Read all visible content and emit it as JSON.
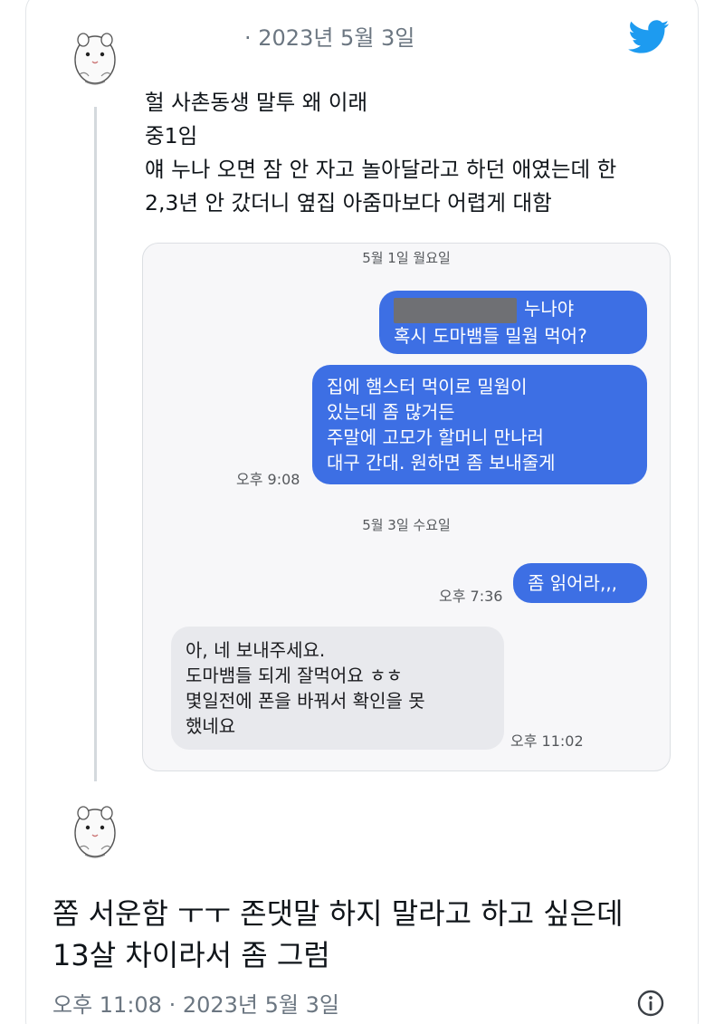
{
  "tweet": {
    "date": "· 2023년 5월 3일",
    "lines": [
      "헐 사촌동생 말투 왜 이래",
      "중1임",
      "얘 누나 오면 잠 안 자고 놀아달라고 하던 애였는데 한",
      "2,3년 안 갔더니 옆집 아줌마보다 어렵게 대함"
    ]
  },
  "embedded_chat": {
    "day1": "5월 1일 월요일",
    "msg1": {
      "line1_suffix": "누나야",
      "line2": "혹시 도마뱀들 밀웜 먹어?"
    },
    "msg2": {
      "lines": [
        "집에 햄스터 먹이로 밀웜이",
        "있는데 좀 많거든",
        "주말에 고모가 할머니 만나러",
        "대구 간대. 원하면 좀 보내줄게"
      ],
      "time": "오후 9:08"
    },
    "day2": "5월 3일 수요일",
    "msg3": {
      "text": "좀 읽어라,,,",
      "time": "오후 7:36"
    },
    "msg4": {
      "lines": [
        "아, 네 보내주세요.",
        "도마뱀들 되게 잘먹어요 ㅎㅎ",
        "몇일전에 폰을 바꿔서 확인을 못",
        "했네요"
      ],
      "time": "오후 11:02"
    }
  },
  "reply": {
    "lines": [
      "쫌 서운함 ㅜㅜ 존댓말 하지 말라고 하고 싶은데",
      "13살 차이라서 좀 그럼"
    ],
    "meta": "오후 11:08 · 2023년 5월 3일"
  },
  "icons": {
    "brand": "twitter-bird-icon",
    "info": "info-icon",
    "avatar": "hamster-avatar"
  },
  "colors": {
    "twitter_blue": "#1d9bf0",
    "sent_bubble": "#3d6fe4",
    "recv_bubble": "#e8e9ed",
    "meta_gray": "#6b7681"
  }
}
